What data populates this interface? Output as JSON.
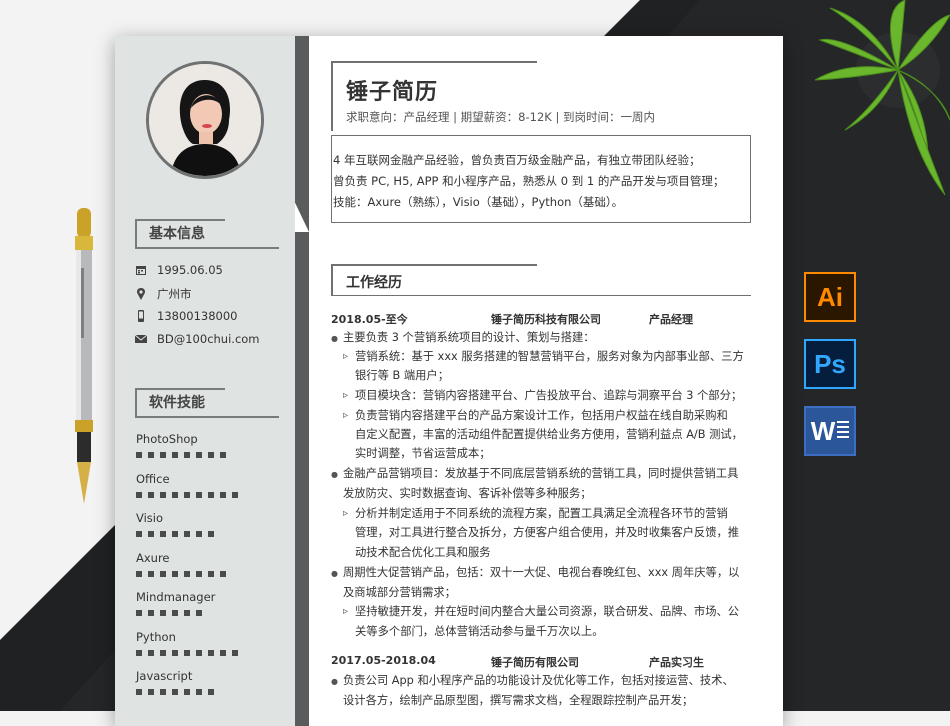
{
  "name": "锤子简历",
  "intent": "求职意向：产品经理 | 期望薪资：8-12K | 到岗时间：一周内",
  "summary": [
    "4 年互联网金融产品经验，曾负责百万级金融产品，有独立带团队经验；",
    "曾负责 PC, H5, APP 和小程序产品，熟悉从 0 到 1 的产品开发与项目管理；",
    "技能：Axure（熟练），Visio（基础），Python（基础）。"
  ],
  "sidebar": {
    "basic_title": "基本信息",
    "birthday": "1995.06.05",
    "city": "广州市",
    "phone": "13800138000",
    "email": "BD@100chui.com",
    "skills_title": "软件技能",
    "skills": [
      {
        "name": "PhotoShop",
        "level": 8
      },
      {
        "name": "Office",
        "level": 9
      },
      {
        "name": "Visio",
        "level": 7
      },
      {
        "name": "Axure",
        "level": 8
      },
      {
        "name": "Mindmanager",
        "level": 6
      },
      {
        "name": "Python",
        "level": 9
      },
      {
        "name": "Javascript",
        "level": 7
      }
    ]
  },
  "work": {
    "title": "工作经历",
    "jobs": [
      {
        "period": "2018.05-至今",
        "company": "锤子简历科技有限公司",
        "role": "产品经理"
      },
      {
        "period": "2017.05-2018.04",
        "company": "锤子简历有限公司",
        "role": "产品实习生"
      }
    ],
    "lines": [
      "主要负责 3 个营销系统项目的设计、策划与搭建：",
      "营销系统：基于 xxx 服务搭建的智慧营销平台，服务对象为内部事业部、三方",
      "银行等  B  端用户；",
      "项目模块含：营销内容搭建平台、广告投放平台、追踪与洞察平台  3  个部分；",
      "负责营销内容搭建平台的产品方案设计工作，包括用户权益在线自助采购和",
      "自定义配置，丰富的活动组件配置提供给业务方使用，营销利益点  A/B  测试，",
      "实时调整，节省运营成本；",
      "金融产品营销项目：发放基于不同底层营销系统的营销工具，同时提供营销工具",
      "发放防灾、实时数据查询、客诉补偿等多种服务；",
      "分析并制定适用于不同系统的流程方案，配置工具满足全流程各环节的营销",
      "管理，对工具进行整合及拆分，方便客户组合使用，并及时收集客户反馈，推",
      "动技术配合优化工具和服务",
      "周期性大促营销产品，包括：双十一大促、电视台春晚红包、xxx 周年庆等，以",
      "及商城部分营销需求；",
      "坚持敏捷开发，并在短时间内整合大量公司资源，联合研发、品牌、市场、公",
      "关等多个部门，总体营销活动参与量千万次以上。",
      "负责公司 App 和小程序产品的功能设计及优化等工作，包括对接运营、技术、",
      "设计各方，绘制产品原型图，撰写需求文档，全程跟踪控制产品开发；"
    ]
  },
  "apps": {
    "ai": "Ai",
    "ps": "Ps",
    "word": "W"
  }
}
